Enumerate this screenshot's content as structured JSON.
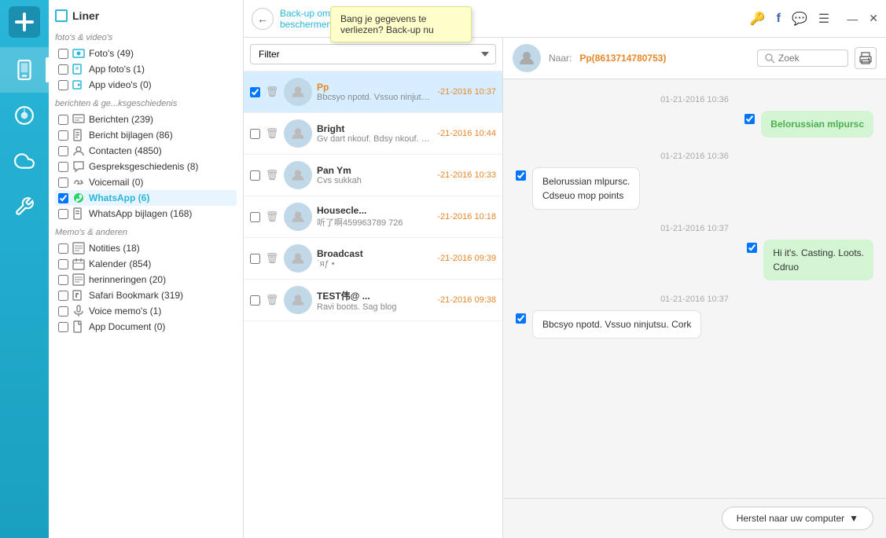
{
  "app": {
    "title": "Liner",
    "logo_icon": "plus-icon"
  },
  "sidebar_icons": [
    {
      "id": "phone-icon",
      "label": "Phone",
      "active": true
    },
    {
      "id": "music-icon",
      "label": "Music",
      "active": false
    },
    {
      "id": "cloud-icon",
      "label": "Cloud",
      "active": false
    },
    {
      "id": "tools-icon",
      "label": "Tools",
      "active": false
    }
  ],
  "tree": {
    "header": "Liner",
    "sections": [
      {
        "label": "foto's & video's",
        "items": [
          {
            "id": "fotos",
            "label": "Foto's (49)",
            "checked": false,
            "icon": "fotos-icon"
          },
          {
            "id": "app-fotos",
            "label": "App foto's (1)",
            "checked": false,
            "icon": "app-fotos-icon"
          },
          {
            "id": "app-videos",
            "label": "App video's (0)",
            "checked": false,
            "icon": "app-videos-icon"
          }
        ]
      },
      {
        "label": "berichten & ge...ksgeschiedenis",
        "items": [
          {
            "id": "berichten",
            "label": "Berichten (239)",
            "checked": false,
            "icon": "berichten-icon"
          },
          {
            "id": "bericht-bijlagen",
            "label": "Bericht bijlagen (86)",
            "checked": false,
            "icon": "bijlagen-icon"
          },
          {
            "id": "contacten",
            "label": "Contacten (4850)",
            "checked": false,
            "icon": "contacten-icon"
          },
          {
            "id": "gespreks",
            "label": "Gespreksgeschiedenis (8)",
            "checked": false,
            "icon": "gespreks-icon"
          },
          {
            "id": "voicemail",
            "label": "Voicemail (0)",
            "checked": false,
            "icon": "voicemail-icon"
          },
          {
            "id": "whatsapp",
            "label": "WhatsApp (6)",
            "checked": true,
            "icon": "whatsapp-icon",
            "highlighted": true
          },
          {
            "id": "whatsapp-bijlagen",
            "label": "WhatsApp bijlagen (168)",
            "checked": false,
            "icon": "whatsapp-bijlagen-icon"
          }
        ]
      },
      {
        "label": "Memo's & anderen",
        "items": [
          {
            "id": "notities",
            "label": "Notities (18)",
            "checked": false,
            "icon": "notities-icon"
          },
          {
            "id": "kalender",
            "label": "Kalender (854)",
            "checked": false,
            "icon": "kalender-icon"
          },
          {
            "id": "herinneringen",
            "label": "herinneringen (20)",
            "checked": false,
            "icon": "herinneringen-icon"
          },
          {
            "id": "safari",
            "label": "Safari Bookmark (319)",
            "checked": false,
            "icon": "safari-icon"
          },
          {
            "id": "voice-memo",
            "label": "Voice memo's (1)",
            "checked": false,
            "icon": "voice-memo-icon"
          },
          {
            "id": "app-document",
            "label": "App Document (0)",
            "checked": false,
            "icon": "app-document-icon"
          }
        ]
      }
    ]
  },
  "topbar": {
    "back_button": "←",
    "backup_link_line1": "Back-up om je",
    "backup_link_line2": "beschermen >>",
    "window_controls": {
      "minimize": "—",
      "close": "✕"
    }
  },
  "tooltip": {
    "text": "Bang je gegevens te verliezen? Back-up nu"
  },
  "filter": {
    "label": "Filter",
    "placeholder": "Filter"
  },
  "search": {
    "placeholder": "Zoek"
  },
  "messages": [
    {
      "id": "msg1",
      "name": "Pp",
      "name_color": "orange",
      "time": "-21-2016 10:37",
      "preview": "Bbcsyo npotd. Vssuo ninjutsu...",
      "selected": true
    },
    {
      "id": "msg2",
      "name": "Bright",
      "name_color": "normal",
      "time": "-21-2016 10:44",
      "preview": "Gv dart nkouf. Bdsy nkouf. Bd...",
      "selected": false
    },
    {
      "id": "msg3",
      "name": "Pan Ym",
      "name_color": "normal",
      "time": "-21-2016 10:33",
      "preview": "Cvs sukkah",
      "selected": false
    },
    {
      "id": "msg4",
      "name": "Housecle...",
      "name_color": "normal",
      "time": "-21-2016 10:18",
      "preview": "听了啊459963789 726",
      "selected": false
    },
    {
      "id": "msg5",
      "name": "Broadcast",
      "name_color": "normal",
      "time": "-21-2016 09:39",
      "preview": "ʾяƒ  •",
      "selected": false
    },
    {
      "id": "msg6",
      "name": "TEST伟@ ...",
      "name_color": "normal",
      "time": "-21-2016 09:38",
      "preview": "Ravi boots. Sag blog",
      "selected": false
    }
  ],
  "chat": {
    "to_label": "Naar:",
    "to_number": "Pp(8613714780753)",
    "messages": [
      {
        "id": "cm1",
        "date": "01-21-2016 10:36",
        "bubbles": [
          {
            "text": "Belorussian mlpursc",
            "side": "right",
            "type": "green",
            "color_text": true
          }
        ]
      },
      {
        "id": "cm2",
        "date": "01-21-2016 10:36",
        "bubbles": [
          {
            "text": "Belorussian mlpursc.\nCdseuo mop points",
            "side": "left",
            "type": "white",
            "color_text": false
          }
        ]
      },
      {
        "id": "cm3",
        "date": "01-21-2016 10:37",
        "bubbles": [
          {
            "text": "Hi it's. Casting. Loots.\nCdruo",
            "side": "right",
            "type": "green",
            "color_text": false
          }
        ]
      },
      {
        "id": "cm4",
        "date": "01-21-2016 10:37",
        "bubbles": [
          {
            "text": "Bbcsyo npotd. Vssuo ninjutsu.  Cork",
            "side": "left",
            "type": "white",
            "color_text": false
          }
        ]
      }
    ]
  },
  "bottom": {
    "restore_btn": "Herstel naar uw computer"
  }
}
